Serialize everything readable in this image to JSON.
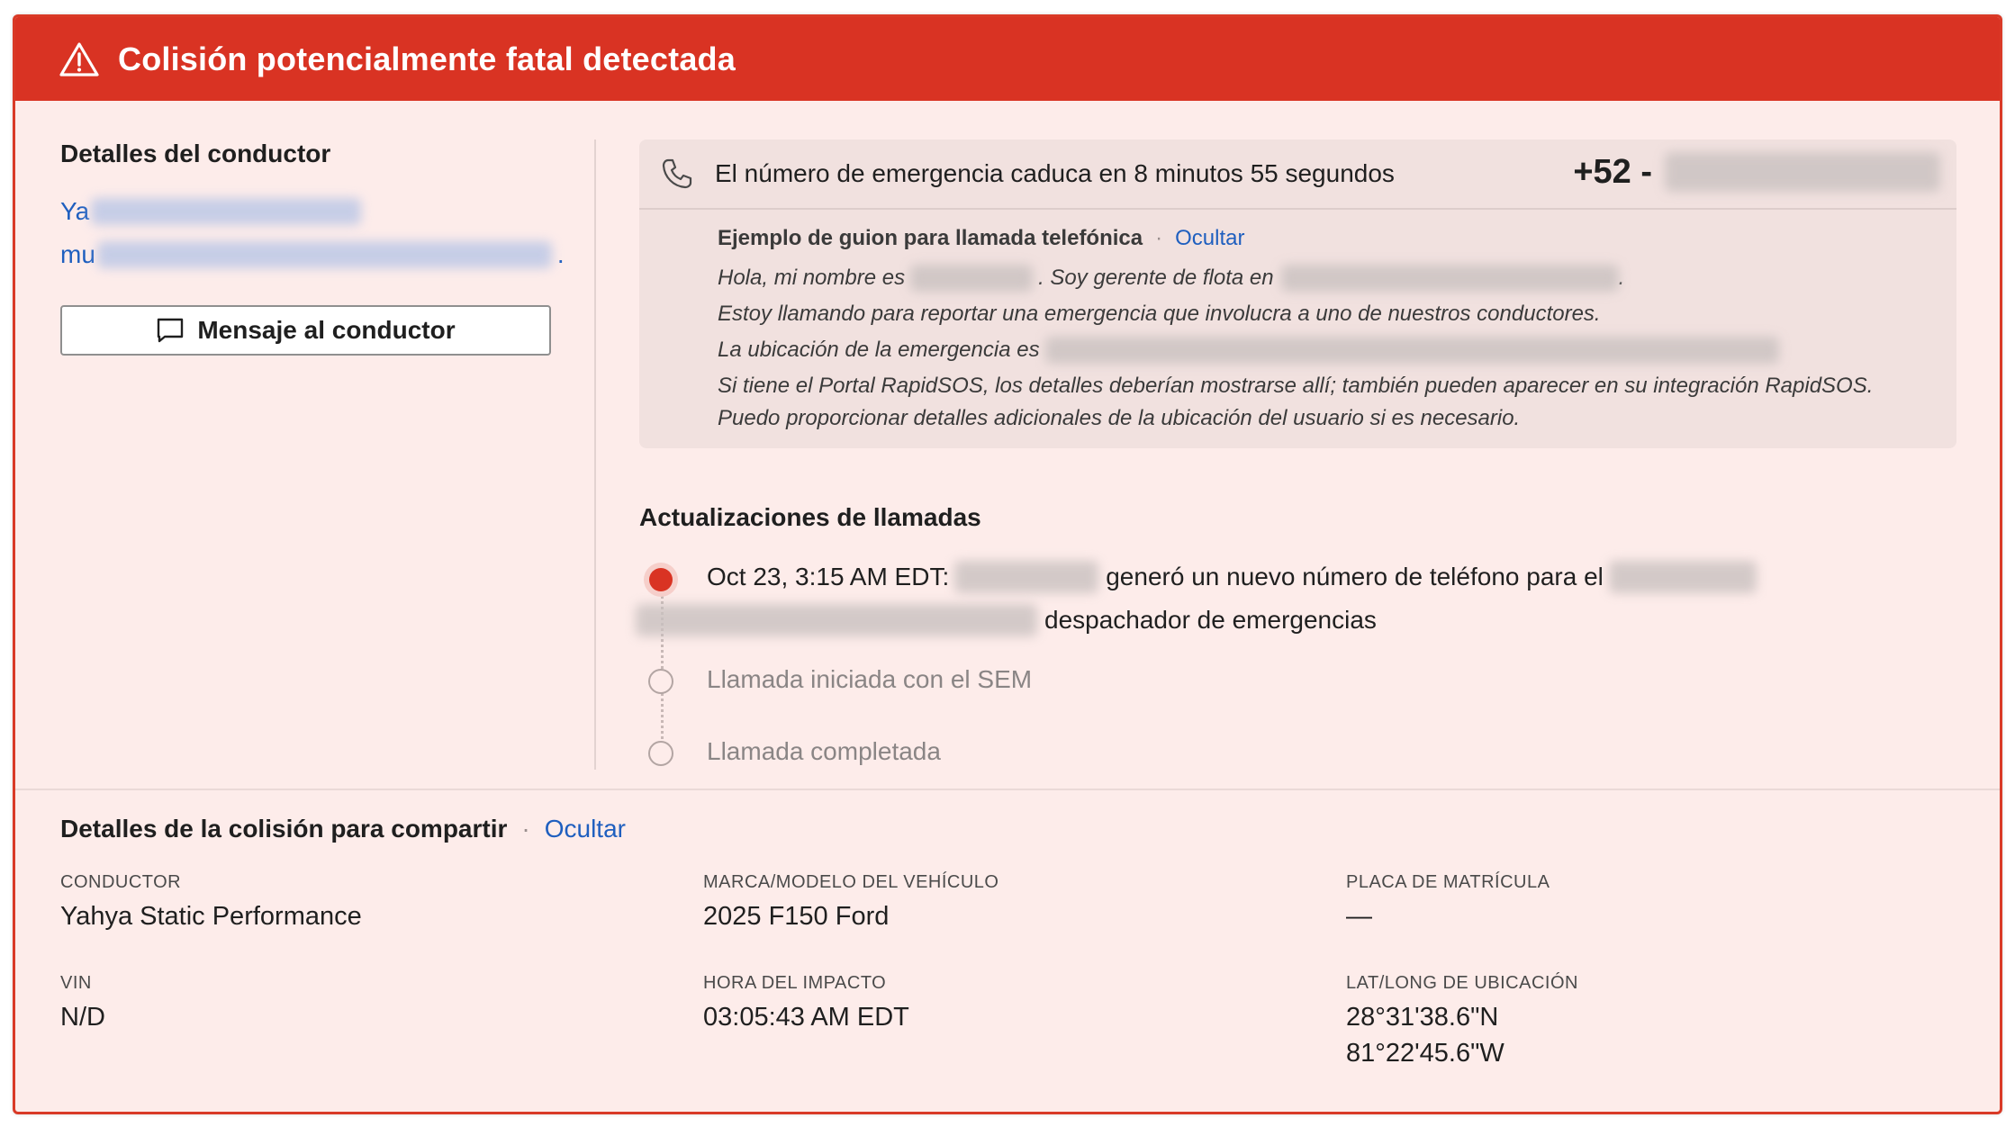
{
  "header": {
    "title": "Colisión potencialmente fatal detectada",
    "icon": "warning-triangle-icon",
    "color": "#d93323"
  },
  "driver": {
    "section_title": "Detalles del conductor",
    "name_visible_prefix": "Ya",
    "email_visible_prefix": "mu",
    "email_visible_suffix": ".",
    "message_button": "Mensaje al conductor"
  },
  "emergency": {
    "expiry_text": "El número de emergencia caduca en 8 minutos 55 segundos",
    "number_prefix": "+52 -",
    "script_title": "Ejemplo de guion para llamada telefónica",
    "script_hide": "Ocultar",
    "script": {
      "line1_a": "Hola, mi nombre es",
      "line1_b": ". Soy gerente de flota en",
      "line1_c": ".",
      "line2": "Estoy llamando para reportar una emergencia que involucra a uno de nuestros conductores.",
      "line3": "La ubicación de la emergencia es",
      "line4": "Si tiene el Portal RapidSOS, los detalles deberían mostrarse allí; también pueden aparecer en su integración RapidSOS.",
      "line5": "Puedo proporcionar detalles adicionales de la ubicación del usuario si es necesario."
    }
  },
  "updates": {
    "title": "Actualizaciones de llamadas",
    "item1_time": "Oct 23, 3:15 AM EDT:",
    "item1_mid": "generó un nuevo número de teléfono para el",
    "item1_end": "despachador de emergencias",
    "item2": "Llamada iniciada con el SEM",
    "item3": "Llamada completada"
  },
  "collision": {
    "title": "Detalles de la colisión para compartir",
    "hide": "Ocultar",
    "driver_label": "CONDUCTOR",
    "driver_value": "Yahya Static Performance",
    "vehicle_label": "MARCA/MODELO DEL VEHÍCULO",
    "vehicle_value": "2025 F150 Ford",
    "plate_label": "PLACA DE MATRÍCULA",
    "plate_value": "—",
    "vin_label": "VIN",
    "vin_value": "N/D",
    "impact_label": "HORA DEL IMPACTO",
    "impact_value": "03:05:43 AM EDT",
    "location_label": "LAT/LONG DE UBICACIÓN",
    "location_lat": "28°31'38.6\"N",
    "location_long": "81°22'45.6\"W"
  }
}
